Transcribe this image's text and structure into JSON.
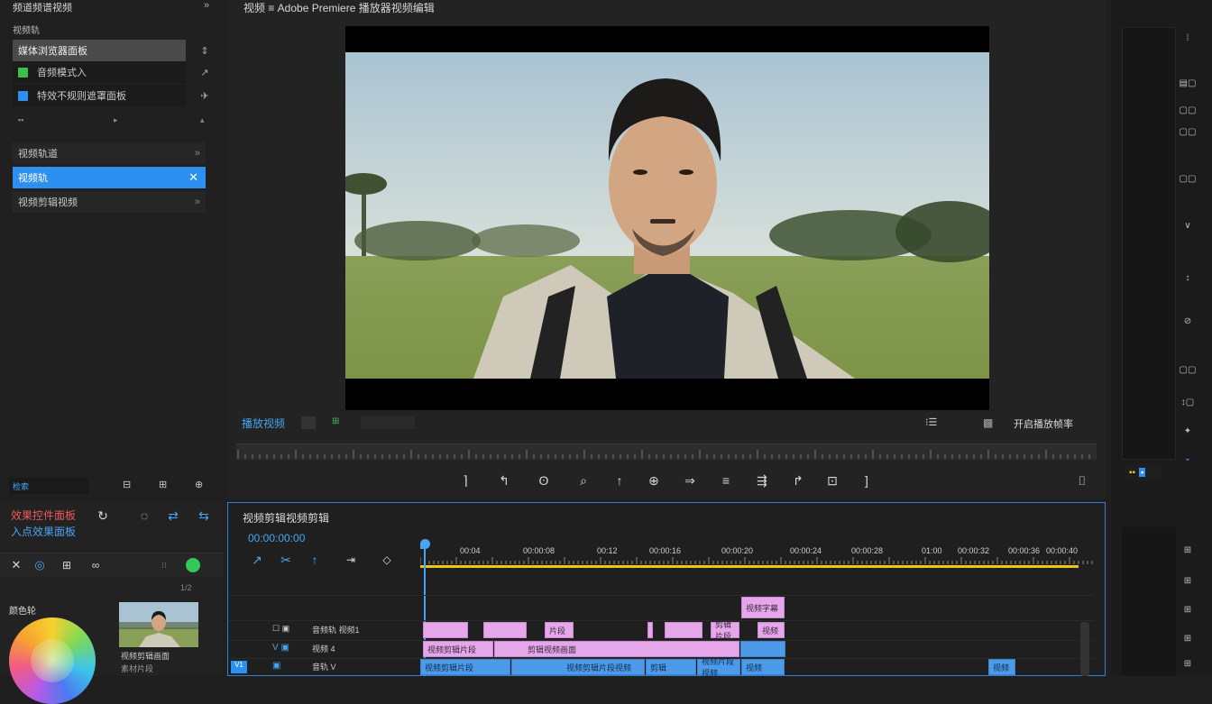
{
  "left_panel": {
    "header": "频道频谱视频",
    "header_arrow": "»",
    "section_label": "视频轨",
    "items": [
      {
        "label": "媒体浏览器面板",
        "side": "⇕",
        "color": "#5b5b5b"
      },
      {
        "label": "音频模式入",
        "side": "↗",
        "color": "#3cc04a"
      },
      {
        "label": "特效不规则遮罩面板",
        "side": "✈",
        "color": "#2d8ff0"
      }
    ],
    "sub_row_left": "▪▪",
    "sub_row_mid": "▸",
    "sub_row_right": "▴",
    "list": [
      {
        "label": "视频轨道",
        "side": "»"
      },
      {
        "label": "视频轨",
        "side": "✕"
      },
      {
        "label": "视频剪辑视频",
        "side": "»"
      }
    ],
    "footer_left": "检索",
    "footer_icons": [
      "⊟",
      "⊞",
      "⊕"
    ]
  },
  "monitor": {
    "title": "视频 ≡ Adobe Premiere 播放器视频编辑",
    "timecode": "播放视频",
    "status_left": "⊞",
    "status_right_icon": "⁝☰",
    "status_right": "开启播放帧率",
    "camera_icon": "▩",
    "controls": [
      "⌉",
      "↰",
      "ʘ",
      "⌕",
      "↑",
      "⊕",
      "⇒",
      "≡",
      "⇶",
      "↱",
      "⊡",
      "]",
      "⌷"
    ]
  },
  "bottom_left": {
    "title": "效果控件面板",
    "subtitle": "入点效果面板",
    "top_icons": [
      "↻",
      "◌",
      "⇄",
      "⇆"
    ],
    "tabs": [
      "✕",
      "◎",
      "⊞",
      "∞"
    ],
    "tab_extra": "⁝⁝",
    "color_label": "颜色轮",
    "thumb_label": "视频剪辑画面",
    "thumb_sub": "素材片段",
    "scale_label": "1/2"
  },
  "timeline": {
    "title": "视频剪辑视频剪辑",
    "timecode": "00:00:00:00",
    "tools": [
      "↗",
      "✂",
      "↑",
      "⇥",
      "◇"
    ],
    "ruler_labels": [
      "00:04",
      "00:00:08",
      "00:12",
      "00:00:16",
      "00:00:20",
      "00:00:24",
      "00:00:28",
      "01:00",
      "00:00:32",
      "00:00:36",
      "00:00:40"
    ],
    "track_labels": [
      {
        "icons": "☐ ▣",
        "name": "音频轨 视频1"
      },
      {
        "icons": "V ▣",
        "name": "视频 4"
      },
      {
        "icons": "▣",
        "name": "音轨 V"
      }
    ],
    "clips_row1": [
      "",
      "",
      "片段",
      "",
      "",
      "剪辑片段",
      "视频"
    ],
    "clips_row2": [
      "视频剪辑片段",
      "剪辑视频画面"
    ],
    "clips_row3": [
      "视频剪辑片段",
      "视频剪辑片段视频",
      "剪辑",
      "视频片段视频",
      "视频",
      "视频"
    ],
    "overlay_clip": "视频字幕",
    "track_chip": "V1"
  },
  "right_panel": {
    "buttons": [
      "⁞",
      "▤▢",
      "▢▢",
      "▢▢",
      "▢▢",
      "∨",
      "↕",
      "⊘",
      "▢▢",
      "↕▢",
      "✦",
      "⌄"
    ],
    "lower_buttons": [
      "⊞",
      "⊞",
      "⊞",
      "⊞",
      "⊞"
    ],
    "accent_icons": [
      "▪▪",
      "▪"
    ]
  },
  "colors": {
    "accent": "#2d8ff0",
    "pink_clip": "#e6a6ea",
    "blue_clip": "#4d9be8",
    "timeline_bar": "#f0c419",
    "panel": "#232323"
  }
}
